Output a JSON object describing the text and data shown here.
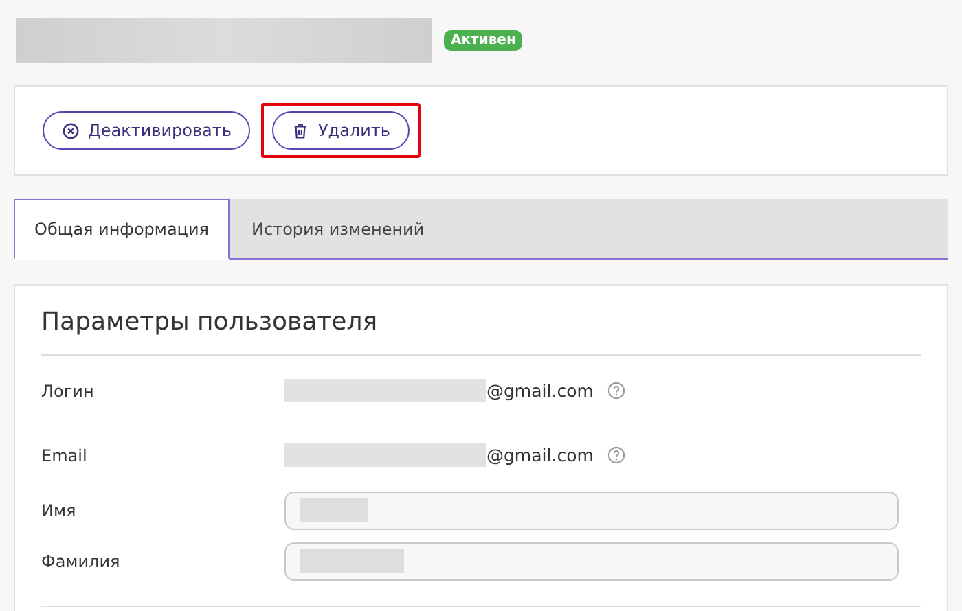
{
  "header": {
    "status_badge": "Активен"
  },
  "actions": [
    {
      "kind": "deactivate",
      "label": "Деактивировать",
      "highlighted": false
    },
    {
      "kind": "delete",
      "label": "Удалить",
      "highlighted": true
    }
  ],
  "tabs": [
    {
      "label": "Общая информация",
      "selected": true
    },
    {
      "label": "История изменений",
      "selected": false
    }
  ],
  "section": {
    "title": "Параметры пользователя",
    "fields": [
      {
        "kind": "text",
        "label": "Логин",
        "value": "@gmail.com",
        "help": true
      },
      {
        "kind": "text",
        "label": "Email",
        "value": "@gmail.com",
        "help": true
      },
      {
        "kind": "input",
        "label": "Имя"
      },
      {
        "kind": "input",
        "label": "Фамилия"
      }
    ]
  }
}
